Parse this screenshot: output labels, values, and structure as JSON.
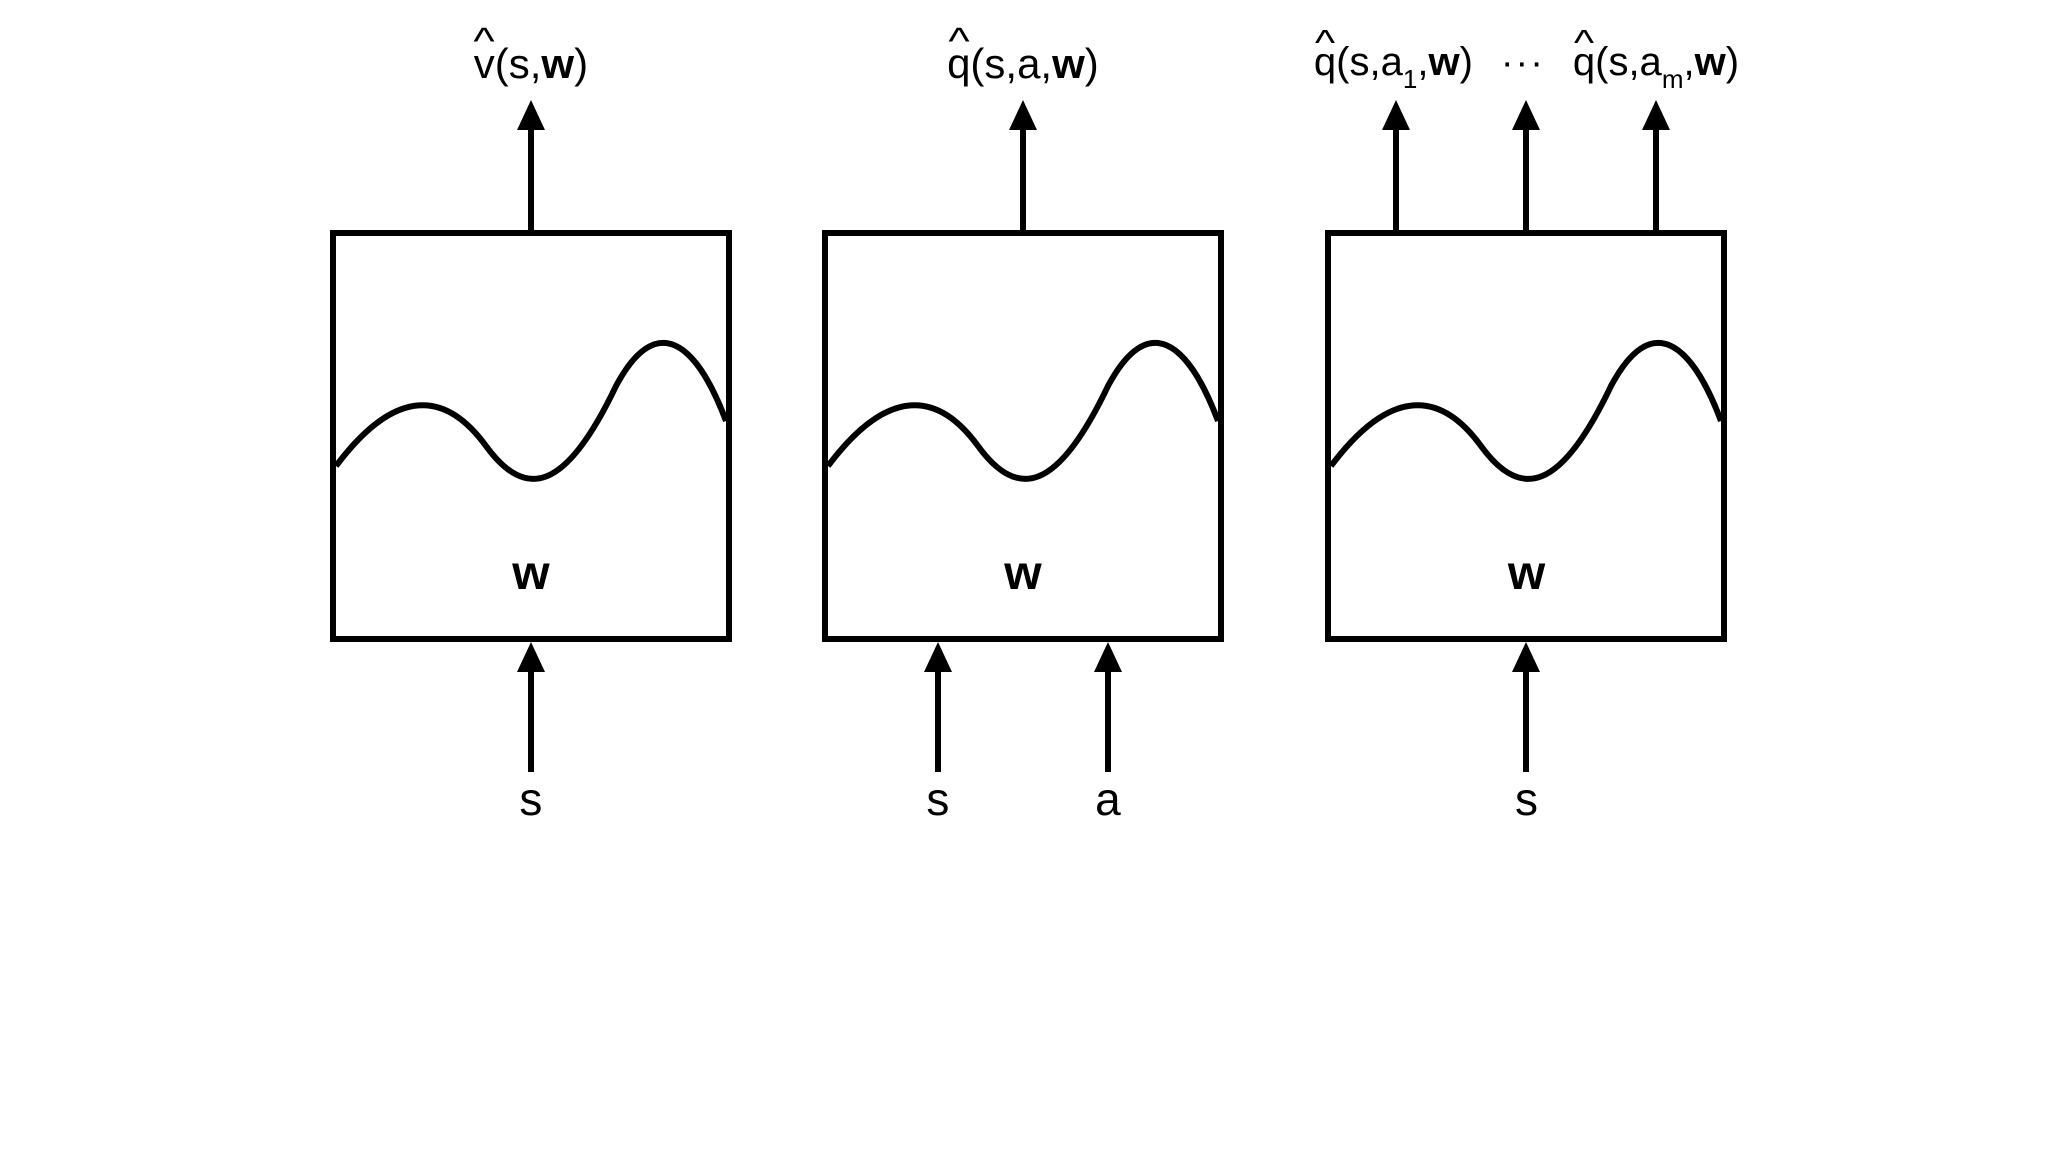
{
  "panels": [
    {
      "outputs": [
        {
          "fn": "v",
          "args_pre": "(s,",
          "args_post": ")"
        }
      ],
      "inputs": [
        "s"
      ],
      "w_label": "w"
    },
    {
      "outputs": [
        {
          "fn": "q",
          "args_pre": "(s,a,",
          "args_post": ")"
        }
      ],
      "inputs": [
        "s",
        "a"
      ],
      "w_label": "w"
    },
    {
      "outputs": [
        {
          "fn": "q",
          "args_pre": "(s,a",
          "sub": "1",
          "args_mid": ",",
          "args_post": ")"
        },
        {
          "dots": "···"
        },
        {
          "fn": "q",
          "args_pre": "(s,a",
          "sub": "m",
          "args_mid": ",",
          "args_post": ")"
        }
      ],
      "out_arrows": 3,
      "inputs": [
        "s"
      ],
      "w_label": "w"
    }
  ]
}
